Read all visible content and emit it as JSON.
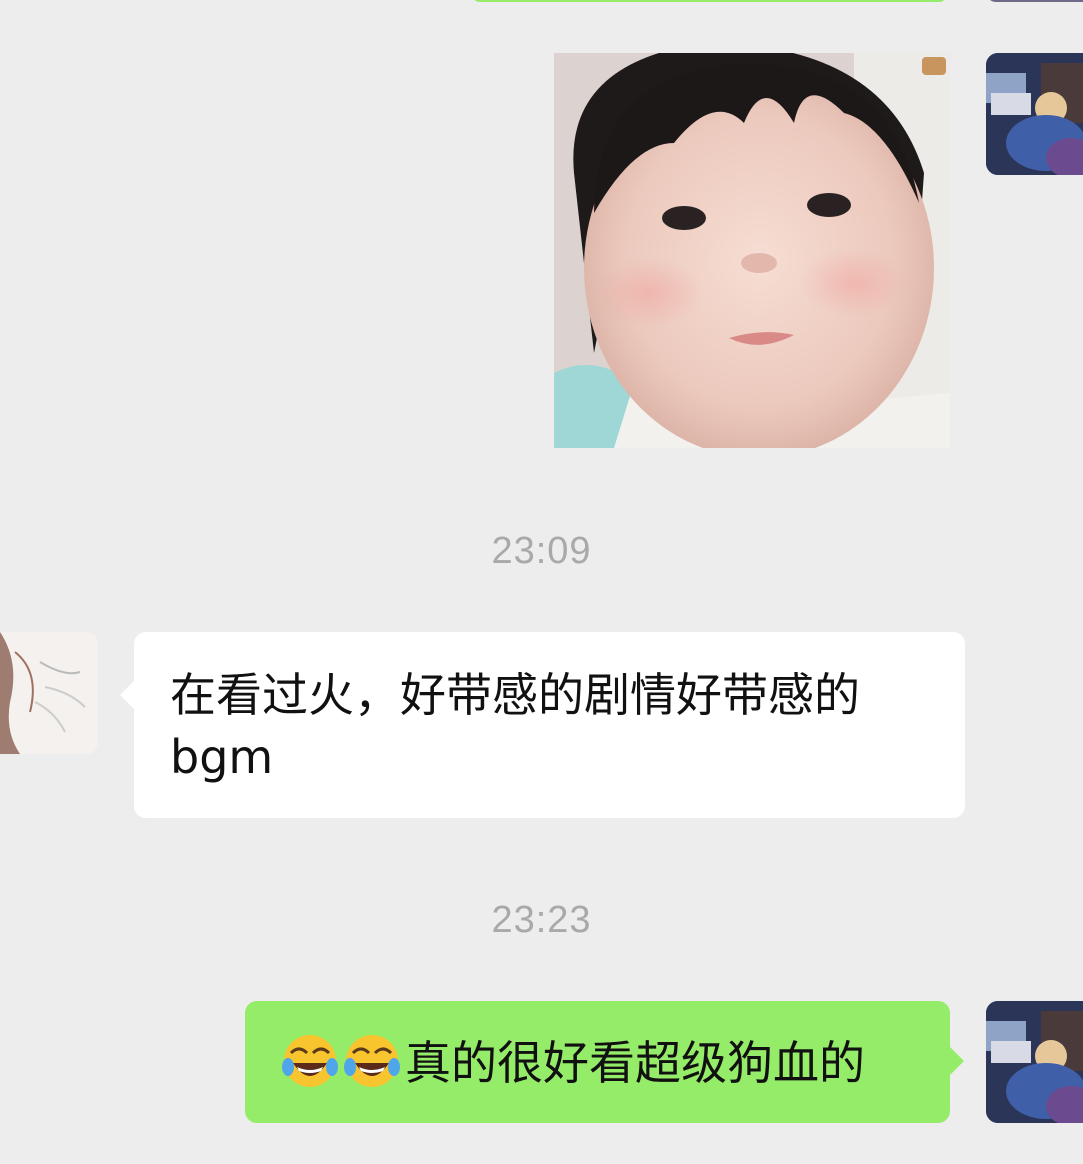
{
  "conversation": {
    "messages": [
      {
        "sender": "me",
        "type": "sticker",
        "sticker": "baby-face-sticker"
      },
      {
        "type": "timestamp",
        "text": "23:09"
      },
      {
        "sender": "other",
        "type": "text",
        "text": "在看过火，好带感的剧情好带感的bgm"
      },
      {
        "type": "timestamp",
        "text": "23:23"
      },
      {
        "sender": "me",
        "type": "text",
        "emoji": [
          "tears-of-joy-emoji",
          "tears-of-joy-emoji"
        ],
        "text": "真的很好看超级狗血的"
      }
    ]
  },
  "colors": {
    "background": "#ededed",
    "outgoing_bubble": "#95ec69",
    "incoming_bubble": "#ffffff",
    "timestamp": "#a9a9a9"
  },
  "icons": {
    "my_avatar": "anime-avatar-icon",
    "other_avatar": "sketch-girl-avatar-icon",
    "emoji": "tears-of-joy-emoji"
  }
}
